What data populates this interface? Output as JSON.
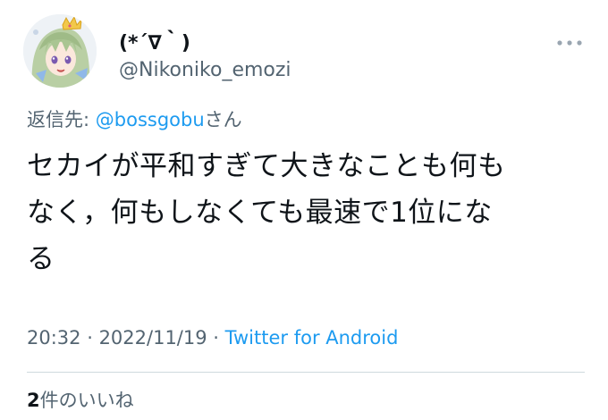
{
  "author": {
    "display_name": "(*´∇｀)",
    "handle": "@Nikoniko_emozi",
    "avatar_icon": "anime-character-avatar"
  },
  "more_icon": "more-horizontal-icon",
  "reply": {
    "prefix": "返信先: ",
    "mention": "@bossgobu",
    "suffix": "さん"
  },
  "body": {
    "line1": "セカイが平和すぎて大きなことも何も",
    "line2": "なく，何もしなくても最速で1位にな",
    "line3": "る"
  },
  "meta": {
    "time": "20:32",
    "sep1": " · ",
    "date": "2022/11/19",
    "sep2": " · ",
    "source": "Twitter for Android"
  },
  "likes": {
    "count": "2",
    "label": "件のいいね"
  },
  "colors": {
    "link": "#1d9bf0",
    "secondary_text": "#536471",
    "primary_text": "#0f1419",
    "divider": "#cfd9de"
  }
}
